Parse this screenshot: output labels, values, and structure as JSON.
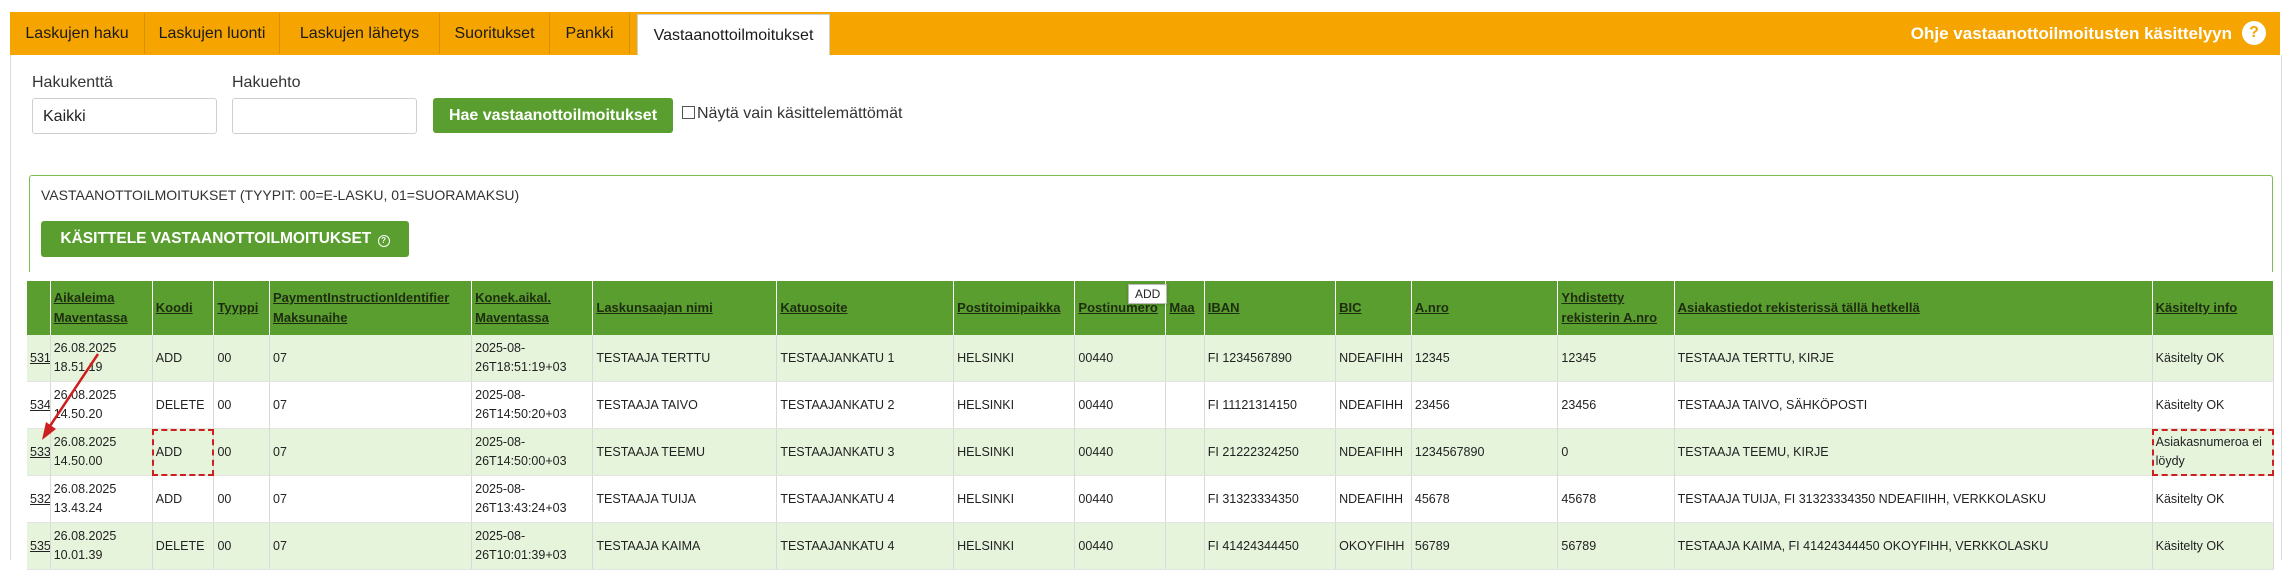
{
  "tabs": [
    {
      "label": "Laskujen haku",
      "active": false
    },
    {
      "label": "Laskujen luonti",
      "active": false
    },
    {
      "label": "Laskujen lähetys",
      "active": false
    },
    {
      "label": "Suoritukset",
      "active": false
    },
    {
      "label": "Pankki",
      "active": false
    },
    {
      "label": "Vastaanottoilmoitukset",
      "active": true
    }
  ],
  "help": {
    "label": "Ohje vastaanottoilmoitusten käsittelyyn",
    "icon": "help-icon",
    "icon_glyph": "?"
  },
  "search": {
    "field_label": "Hakukenttä",
    "field_value": "Kaikki",
    "criteria_label": "Hakuehto",
    "criteria_value": "",
    "search_button": "Hae vastaanottoilmoitukset",
    "only_unprocessed_label": "Näytä vain käsittelemättömät",
    "only_unprocessed_checked": false
  },
  "notifications": {
    "header": "VASTAANOTTOILMOITUKSET (TYYPIT: 00=E-LASKU, 01=SUORAMAKSU)",
    "process_button": "KÄSITTELE VASTAANOTTOILMOITUKSET",
    "process_icon_glyph": "?"
  },
  "tooltip": "ADD",
  "table": {
    "columns": [
      "",
      "Aikaleima Maventassa",
      "Koodi",
      "Tyyppi",
      "PaymentInstructionIdentifier Maksunaihe",
      "Konek.aikal. Maventassa",
      "Laskunsaajan nimi",
      "Katuosoite",
      "Postitoimipaikka",
      "Postinumero",
      "Maa",
      "IBAN",
      "BIC",
      "A.nro",
      "Yhdistetty rekisterin A.nro",
      "Asiakastiedot rekisterissä tällä hetkellä",
      "Käsitelty info"
    ],
    "rows": [
      {
        "id": "531",
        "timestamp": "26.08.2025 18.51.19",
        "code": "ADD",
        "type": "00",
        "payment": "07",
        "machine_time": "2025-08-26T18:51:19+03",
        "name": "TESTAAJA TERTTU",
        "street": "TESTAAJANKATU 1",
        "city": "HELSINKI",
        "postal": "00440",
        "country": "",
        "iban": "FI 1234567890",
        "bic": "NDEAFIHH",
        "anro": "12345",
        "merged_anro": "12345",
        "customer_info": "TESTAAJA TERTTU, KIRJE",
        "processed": "Käsitelty OK"
      },
      {
        "id": "534",
        "timestamp": "26.08.2025 14.50.20",
        "code": "DELETE",
        "type": "00",
        "payment": "07",
        "machine_time": "2025-08-26T14:50:20+03",
        "name": "TESTAAJA TAIVO",
        "street": "TESTAAJANKATU 2",
        "city": "HELSINKI",
        "postal": "00440",
        "country": "",
        "iban": "FI 11121314150",
        "bic": "NDEAFIHH",
        "anro": "23456",
        "merged_anro": "23456",
        "customer_info": "TESTAAJA TAIVO, SÄHKÖPOSTI",
        "processed": "Käsitelty OK"
      },
      {
        "id": "533",
        "timestamp": "26.08.2025 14.50.00",
        "code": "ADD",
        "type": "00",
        "payment": "07",
        "machine_time": "2025-08-26T14:50:00+03",
        "name": "TESTAAJA TEEMU",
        "street": "TESTAAJANKATU 3",
        "city": "HELSINKI",
        "postal": "00440",
        "country": "",
        "iban": "FI 21222324250",
        "bic": "NDEAFIHH",
        "anro": "1234567890",
        "merged_anro": "0",
        "customer_info": "TESTAAJA TEEMU, KIRJE",
        "processed": "Asiakasnumeroa ei löydy"
      },
      {
        "id": "532",
        "timestamp": "26.08.2025 13.43.24",
        "code": "ADD",
        "type": "00",
        "payment": "07",
        "machine_time": "2025-08-26T13:43:24+03",
        "name": "TESTAAJA TUIJA",
        "street": "TESTAAJANKATU 4",
        "city": "HELSINKI",
        "postal": "00440",
        "country": "",
        "iban": "FI 31323334350",
        "bic": "NDEAFIHH",
        "anro": "45678",
        "merged_anro": "45678",
        "customer_info": "TESTAAJA TUIJA, FI 31323334350 NDEAFIIHH, VERKKOLASKU",
        "processed": "Käsitelty OK"
      },
      {
        "id": "535",
        "timestamp": "26.08.2025 10.01.39",
        "code": "DELETE",
        "type": "00",
        "payment": "07",
        "machine_time": "2025-08-26T10:01:39+03",
        "name": "TESTAAJA KAIMA",
        "street": "TESTAAJANKATU 4",
        "city": "HELSINKI",
        "postal": "00440",
        "country": "",
        "iban": "FI 41424344450",
        "bic": "OKOYFIHH",
        "anro": "56789",
        "merged_anro": "56789",
        "customer_info": "TESTAAJA KAIMA, FI 41424344450 OKOYFIHH, VERKKOLASKU",
        "processed": "Käsitelty OK"
      }
    ]
  },
  "colors": {
    "accent": "#f6a400",
    "primary_button": "#5a9e2f",
    "row_alt": "#e6f4dc",
    "annotation": "#cc1f1f"
  }
}
